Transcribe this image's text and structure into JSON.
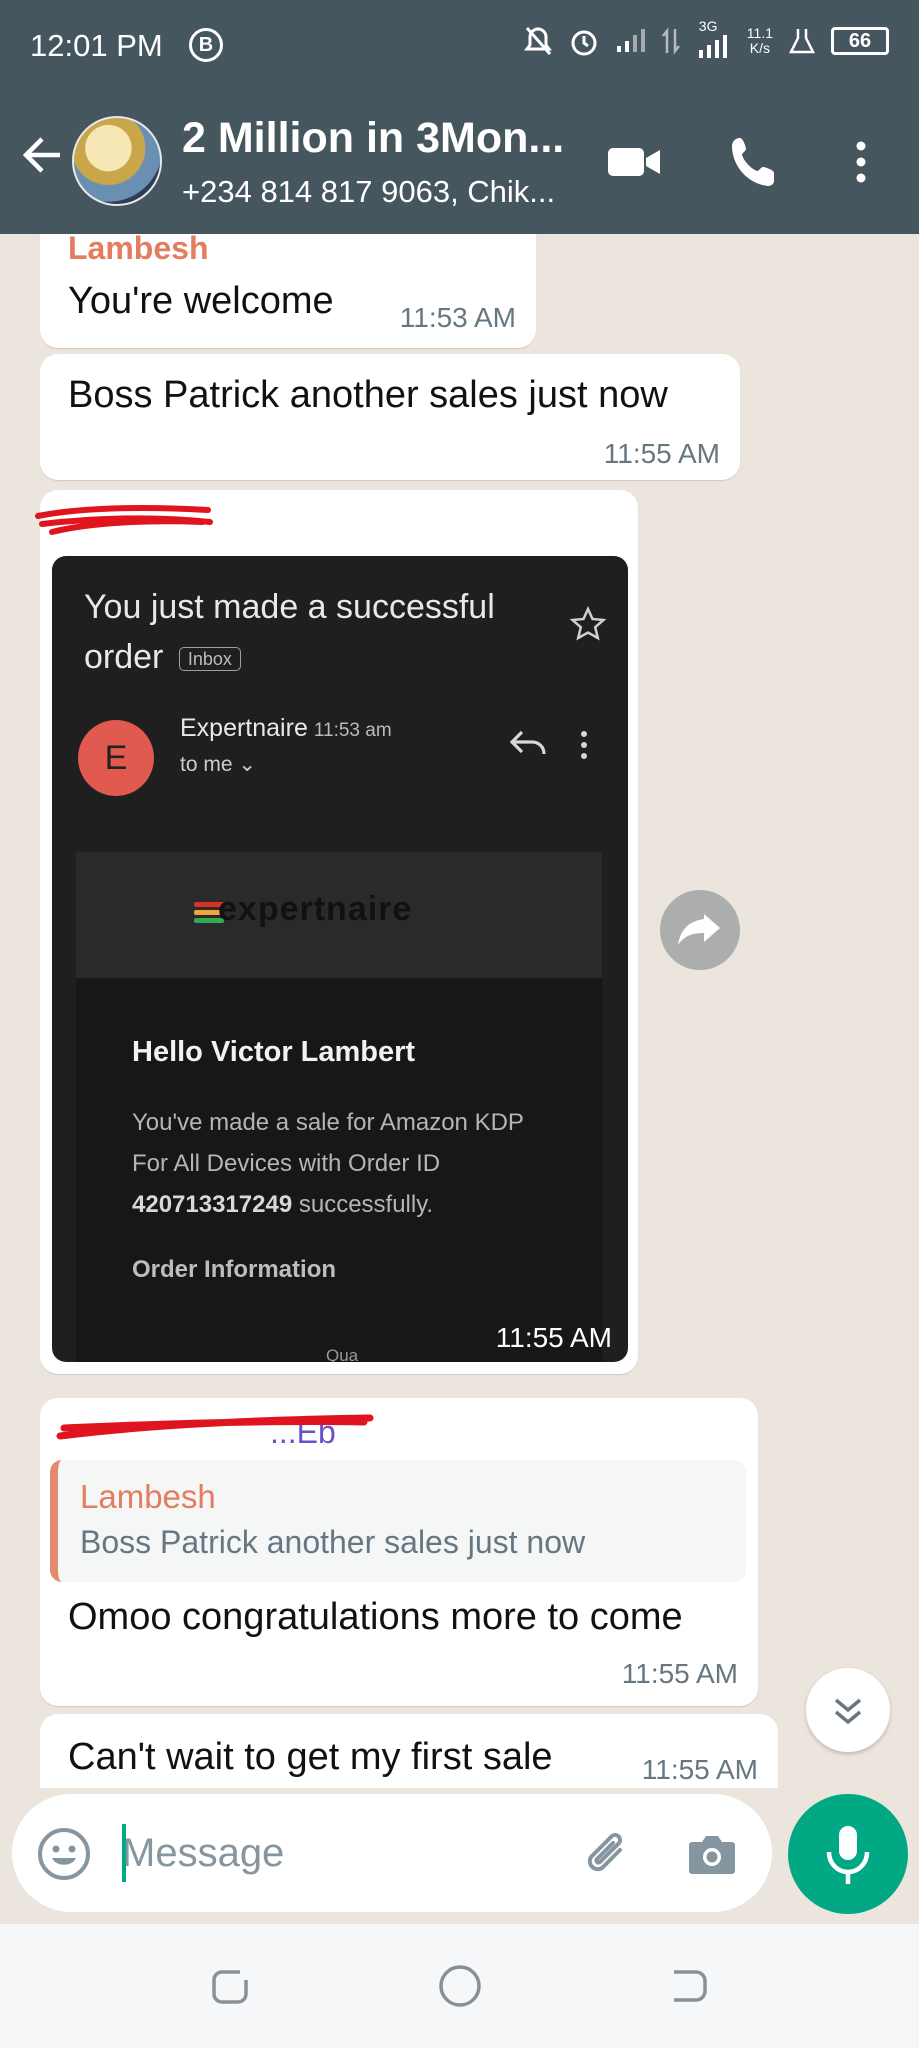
{
  "status_bar": {
    "time": "12:01 PM",
    "b_badge": "B",
    "network": "3G",
    "speed_value": "11.1",
    "speed_unit": "K/s",
    "battery": "66"
  },
  "header": {
    "title": "2 Million in 3Mon...",
    "subtitle": "+234 814 817 9063, Chik..."
  },
  "messages": [
    {
      "sender": "Lambesh",
      "sender_color": "#e27d5f",
      "text": "You're welcome",
      "time": "11:53 AM"
    },
    {
      "sender": "",
      "text": "Boss Patrick another sales just now",
      "time": "11:55 AM"
    },
    {
      "sender": "",
      "time": "11:55 AM",
      "email": {
        "subject": "You just made a successful order",
        "label": "Inbox",
        "from_name": "Expertnaire",
        "avatar_letter": "E",
        "from_time": "11:53 am",
        "to": "to me",
        "brand": "expertnaire",
        "greeting": "Hello Victor Lambert",
        "body_before": "You've made a sale for Amazon KDP For All Devices with Order ID ",
        "order_id": "420713317249",
        "body_after": " successfully.",
        "section": "Order Information",
        "partial": "Qua"
      }
    },
    {
      "sender": "...Eb",
      "sender_color": "#6a4fc9",
      "quote": {
        "sender": "Lambesh",
        "text": "Boss Patrick another sales just now"
      },
      "text": "Omoo congratulations more to come",
      "time": "11:55 AM"
    },
    {
      "sender": "",
      "text": "Can't wait to get my first sale",
      "time": "11:55 AM"
    }
  ],
  "input": {
    "placeholder": "Message"
  },
  "colors": {
    "header_bg": "#46565e",
    "chat_bg": "#ece5dd",
    "accent": "#00a884",
    "redact": "#e0141f",
    "brand_red": "#d93025",
    "brand_orange": "#f2a33a",
    "brand_green": "#34a853"
  },
  "icons": [
    "back-arrow-icon",
    "video-call-icon",
    "voice-call-icon",
    "more-vert-icon",
    "star-icon",
    "reply-icon",
    "share-icon",
    "scroll-down-icon",
    "emoji-icon",
    "attach-icon",
    "camera-icon",
    "mic-icon",
    "recents-icon",
    "home-icon",
    "back-nav-icon"
  ]
}
